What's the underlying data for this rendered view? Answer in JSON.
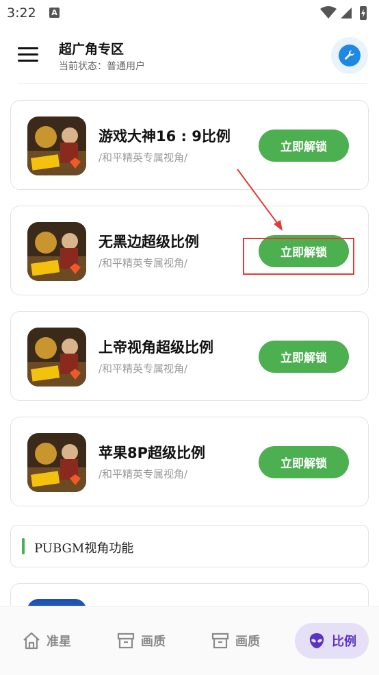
{
  "status_bar": {
    "time": "3:22",
    "notification_icon": "A"
  },
  "header": {
    "title": "超广角专区",
    "subtitle": "当前状态：普通用户",
    "menu_icon": "hamburger-menu-icon",
    "tool_icon": "wrench-icon"
  },
  "cards": [
    {
      "title": "游戏大神16 : 9比例",
      "subtitle": "/和平精英专属视角/",
      "button": "立即解锁"
    },
    {
      "title": "无黑边超级比例",
      "subtitle": "/和平精英专属视角/",
      "button": "立即解锁"
    },
    {
      "title": "上帝视角超级比例",
      "subtitle": "/和平精英专属视角/",
      "button": "立即解锁"
    },
    {
      "title": "苹果8P超级比例",
      "subtitle": "/和平精英专属视角/",
      "button": "立即解锁"
    }
  ],
  "section": {
    "title": "PUBGM视角功能"
  },
  "bottom_nav": {
    "items": [
      {
        "label": "准星",
        "icon": "home-icon",
        "active": false
      },
      {
        "label": "画质",
        "icon": "box-icon",
        "active": false
      },
      {
        "label": "画质",
        "icon": "box-icon",
        "active": false
      },
      {
        "label": "比例",
        "icon": "alien-icon",
        "active": true
      }
    ]
  },
  "colors": {
    "accent_green": "#4caf50",
    "accent_blue": "#1e88e5",
    "active_nav_bg": "#e6e0f7",
    "active_nav_text": "#5b34c4",
    "annotation_red": "#e53935"
  }
}
